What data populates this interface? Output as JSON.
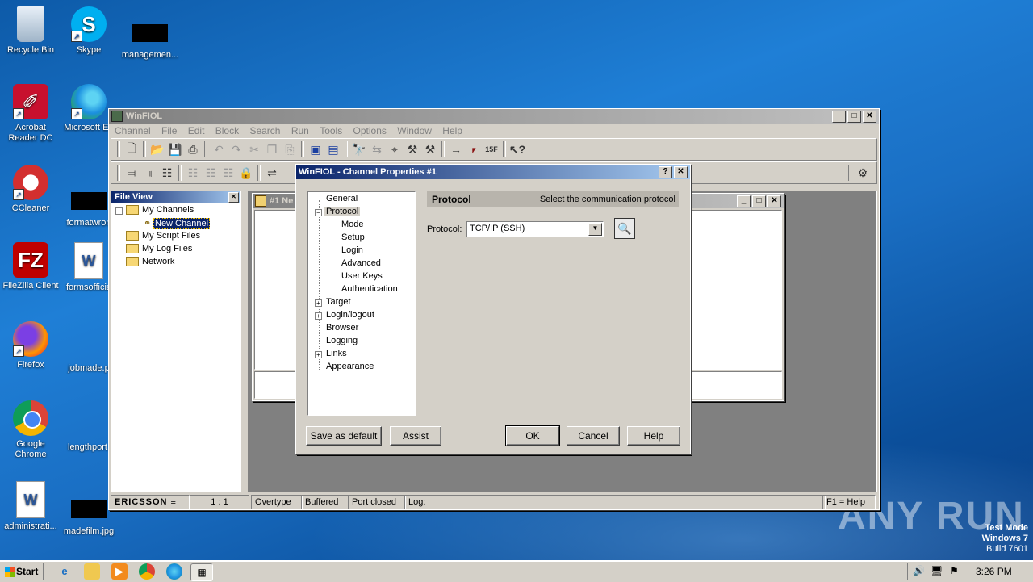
{
  "desktop": {
    "icons": [
      {
        "label": "Recycle Bin"
      },
      {
        "label": "Skype"
      },
      {
        "label": "managemen..."
      },
      {
        "label": "Acrobat Reader DC"
      },
      {
        "label": "Microsoft Ed"
      },
      {
        "label": "CCleaner"
      },
      {
        "label": "formatwron"
      },
      {
        "label": "FileZilla Client"
      },
      {
        "label": "formsofficia"
      },
      {
        "label": "Firefox"
      },
      {
        "label": "jobmade.p"
      },
      {
        "label": "Google Chrome"
      },
      {
        "label": "lengthport."
      },
      {
        "label": "administrati..."
      },
      {
        "label": "madefilm.jpg"
      }
    ],
    "watermark": {
      "text": "ANY RUN",
      "mode": "Test Mode",
      "os": "Windows 7",
      "build": "Build 7601"
    }
  },
  "main_window": {
    "title": "WinFIOL",
    "menu": [
      "Channel",
      "File",
      "Edit",
      "Block",
      "Search",
      "Run",
      "Tools",
      "Options",
      "Window",
      "Help"
    ],
    "file_view": {
      "title": "File View",
      "items": [
        {
          "label": "My Channels"
        },
        {
          "label": "New Channel"
        },
        {
          "label": "My Script Files"
        },
        {
          "label": "My Log Files"
        },
        {
          "label": "Network"
        }
      ]
    },
    "child_window": {
      "title": "#1 Ne"
    },
    "status": {
      "brand": "ERICSSON",
      "position": "1 : 1",
      "mode": "Overtype",
      "buffer": "Buffered",
      "port": "Port closed",
      "log": "Log:",
      "help": "F1 = Help"
    }
  },
  "dialog": {
    "title": "WinFIOL - Channel Properties #1",
    "tree": [
      {
        "label": "General"
      },
      {
        "label": "Protocol"
      },
      {
        "label": "Mode"
      },
      {
        "label": "Setup"
      },
      {
        "label": "Login"
      },
      {
        "label": "Advanced"
      },
      {
        "label": "User Keys"
      },
      {
        "label": "Authentication"
      },
      {
        "label": "Target"
      },
      {
        "label": "Login/logout"
      },
      {
        "label": "Browser"
      },
      {
        "label": "Logging"
      },
      {
        "label": "Links"
      },
      {
        "label": "Appearance"
      }
    ],
    "section_title": "Protocol",
    "section_desc": "Select the communication protocol",
    "protocol_label": "Protocol:",
    "protocol_value": "TCP/IP (SSH)",
    "buttons": {
      "save_default": "Save as default",
      "assist": "Assist",
      "ok": "OK",
      "cancel": "Cancel",
      "help": "Help"
    }
  },
  "taskbar": {
    "start": "Start",
    "clock": "3:26 PM"
  }
}
